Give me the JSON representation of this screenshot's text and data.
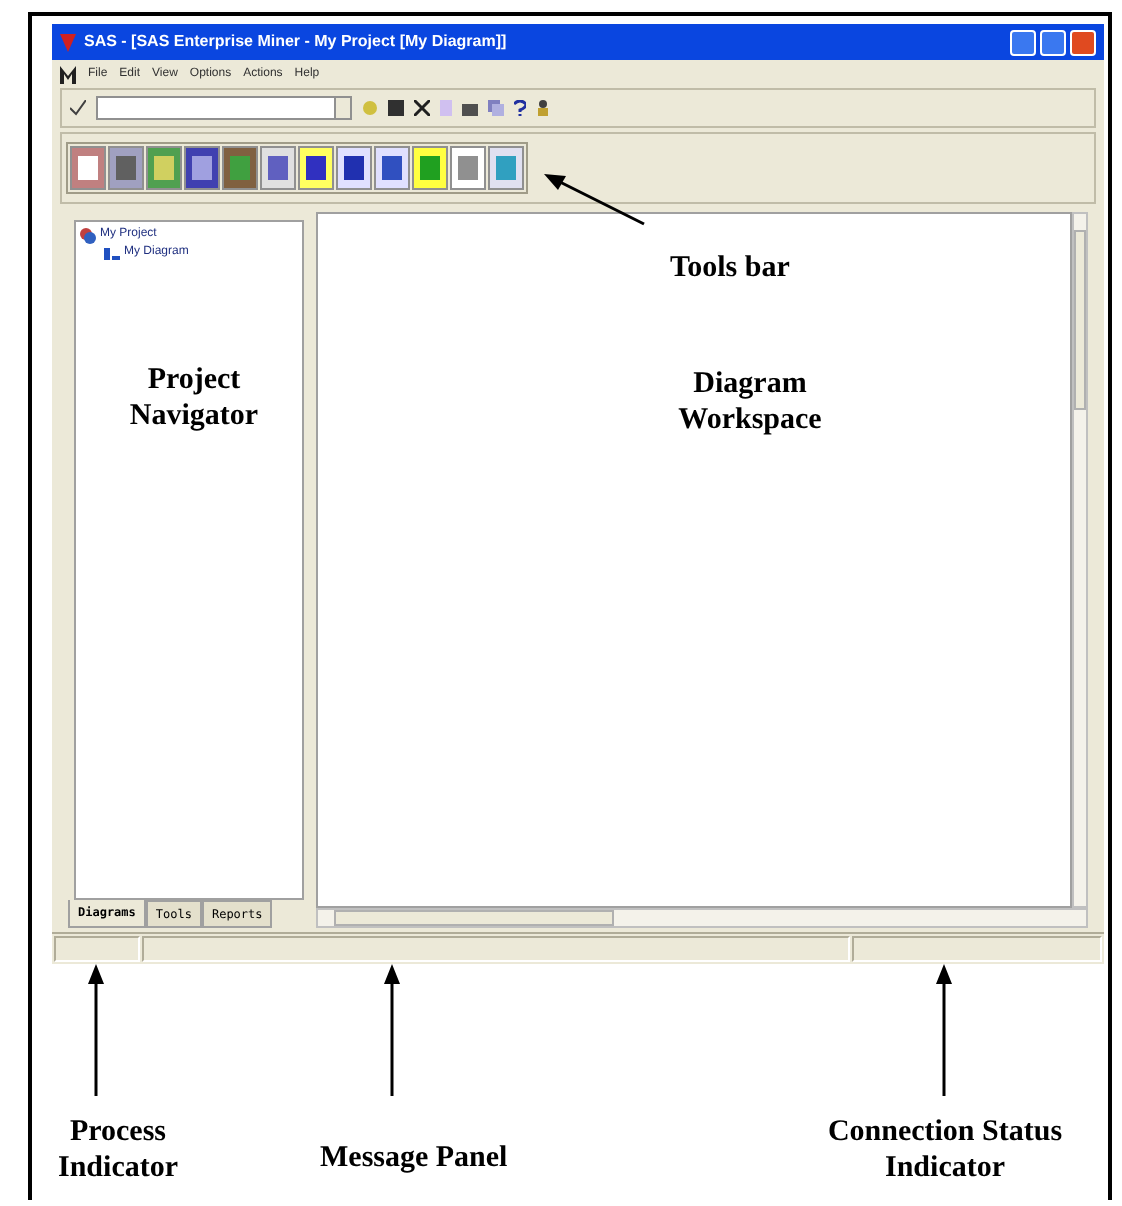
{
  "window": {
    "title": "SAS - [SAS Enterprise Miner - My Project [My Diagram]]"
  },
  "menu": [
    "File",
    "Edit",
    "View",
    "Options",
    "Actions",
    "Help"
  ],
  "navigator": {
    "tree": [
      {
        "label": "My Project",
        "children": [
          {
            "label": "My Diagram"
          }
        ]
      }
    ],
    "tabs": [
      {
        "label": "Diagrams",
        "selected": true
      },
      {
        "label": "Tools",
        "selected": false
      },
      {
        "label": "Reports",
        "selected": false
      }
    ]
  },
  "annotations": {
    "tools_bar": "Tools bar",
    "project_navigator": [
      "Project",
      "Navigator"
    ],
    "diagram_workspace": [
      "Diagram",
      "Workspace"
    ],
    "process_indicator": [
      "Process",
      "Indicator"
    ],
    "message_panel": "Message Panel",
    "connection_status": [
      "Connection Status",
      "Indicator"
    ]
  }
}
